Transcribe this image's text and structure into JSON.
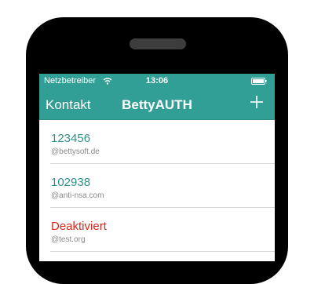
{
  "status_bar": {
    "carrier": "Netzbetreiber",
    "time": "13:06"
  },
  "nav": {
    "left_label": "Kontakt",
    "title": "BettyAUTH",
    "add_icon": "plus-icon"
  },
  "accounts": [
    {
      "code": "123456",
      "account": "@bettysoft.de",
      "active": true
    },
    {
      "code": "102938",
      "account": "@anti-nsa.com",
      "active": true
    },
    {
      "code": "Deaktiviert",
      "account": "@test.org",
      "active": false
    }
  ],
  "colors": {
    "accent": "#329f97",
    "code_active": "#2f8f88",
    "code_inactive": "#d8291c"
  }
}
